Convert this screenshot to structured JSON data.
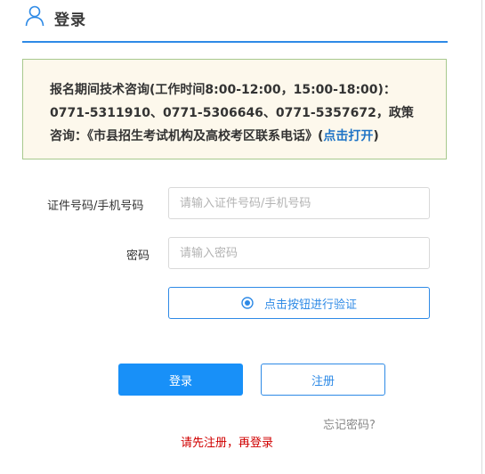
{
  "header": {
    "title": "登录",
    "icon": "user-icon"
  },
  "notice": {
    "text": "报名期间技术咨询(工作时间8:00-12:00，15:00-18:00)：0771-5311910、0771-5306646、0771-5357672，政策咨询：《市县招生考试机构及高校考区联系电话》(",
    "link_text": "点击打开",
    "close_text": ")"
  },
  "form": {
    "id_label": "证件号码/手机号码",
    "id_placeholder": "请输入证件号码/手机号码",
    "id_value": "",
    "password_label": "密码",
    "password_placeholder": "请输入密码",
    "password_value": "",
    "verify_label": "点击按钮进行验证",
    "verify_icon": "radio-target-icon"
  },
  "actions": {
    "login_label": "登录",
    "register_label": "注册",
    "forgot_label": "忘记密码?",
    "warning_text": "请先注册，再登录"
  },
  "colors": {
    "accent": "#2e8ae6",
    "primary_button": "#1890f8",
    "notice_bg": "#fdf8ec",
    "notice_border": "#a8c98d",
    "warning": "#d00000"
  }
}
